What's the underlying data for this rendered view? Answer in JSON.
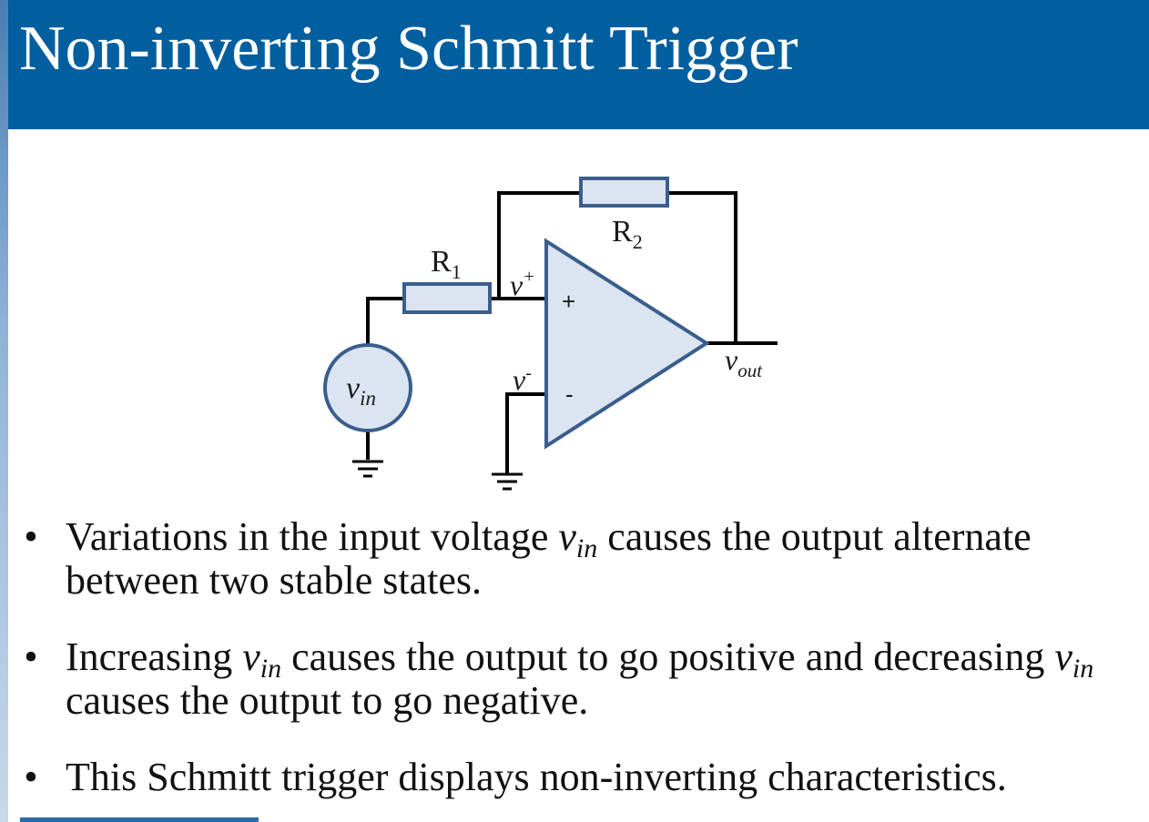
{
  "slide": {
    "title": "Non-inverting Schmitt Trigger"
  },
  "circuit": {
    "r1_label": "R",
    "r1_sub": "1",
    "r2_label": "R",
    "r2_sub": "2",
    "vplus_label": "v",
    "vplus_sup": "+",
    "vminus_label": "v",
    "vminus_sup": "-",
    "vout_label": "v",
    "vout_sub": "out",
    "vin_label": "v",
    "vin_sub": "in",
    "plus_sign": "+",
    "minus_sign": "-",
    "colors": {
      "fill": "#dbe4f1",
      "stroke": "#3a5e8c",
      "wire": "#000000"
    }
  },
  "bullets": [
    {
      "before": "Variations in the input voltage ",
      "var": "v",
      "sub": "in",
      "after": " causes the output alternate between two stable states."
    },
    {
      "before": "Increasing ",
      "var": "v",
      "sub": "in",
      "middle": " causes the output to go positive and decreasing ",
      "var2": "v",
      "sub2": "in",
      "after": " causes the output to go negative."
    },
    {
      "text": "This Schmitt trigger displays non-inverting characteristics."
    }
  ],
  "bullet_symbol": "•",
  "colors": {
    "title_bar": "#015e9f",
    "title_text": "#ffffff"
  }
}
